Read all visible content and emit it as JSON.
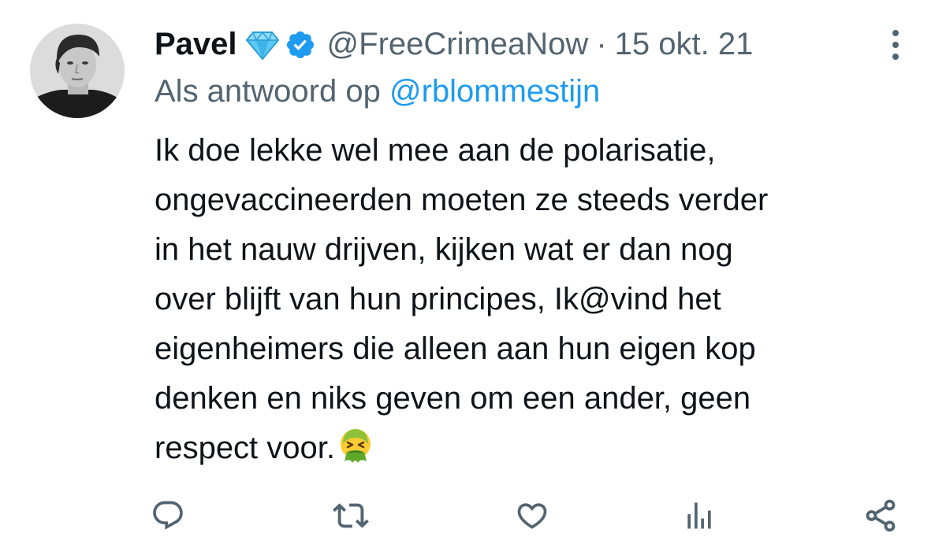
{
  "tweet": {
    "author": {
      "display_name": "Pavel",
      "handle": "@FreeCrimeaNow",
      "avatar_icon": "profile-photo"
    },
    "separator": "·",
    "date": "15 okt. 21",
    "reply_prefix": "Als antwoord op",
    "reply_to": "@rblommestijn",
    "text_lines": [
      "Ik doe lekke wel mee aan de polarisatie,",
      "ongevaccineerden moeten ze steeds verder",
      "in het nauw drijven, kijken wat er dan nog",
      "over blijft van hun principes, Ik@vind het",
      "eigenheimers die alleen aan hun eigen kop",
      "denken en niks geven om een ander, geen",
      "respect voor."
    ],
    "emoji": "vomiting-face",
    "badges": [
      "diamond-icon",
      "verified-icon"
    ]
  },
  "actions": {
    "reply_icon": "reply-icon",
    "retweet_icon": "retweet-icon",
    "like_icon": "heart-icon",
    "views_icon": "views-icon",
    "share_icon": "share-icon"
  },
  "colors": {
    "text": "#0f1419",
    "secondary": "#536471",
    "link": "#1d9bf0",
    "verified": "#1d9bf0",
    "diamond": "#5cc8f2"
  }
}
